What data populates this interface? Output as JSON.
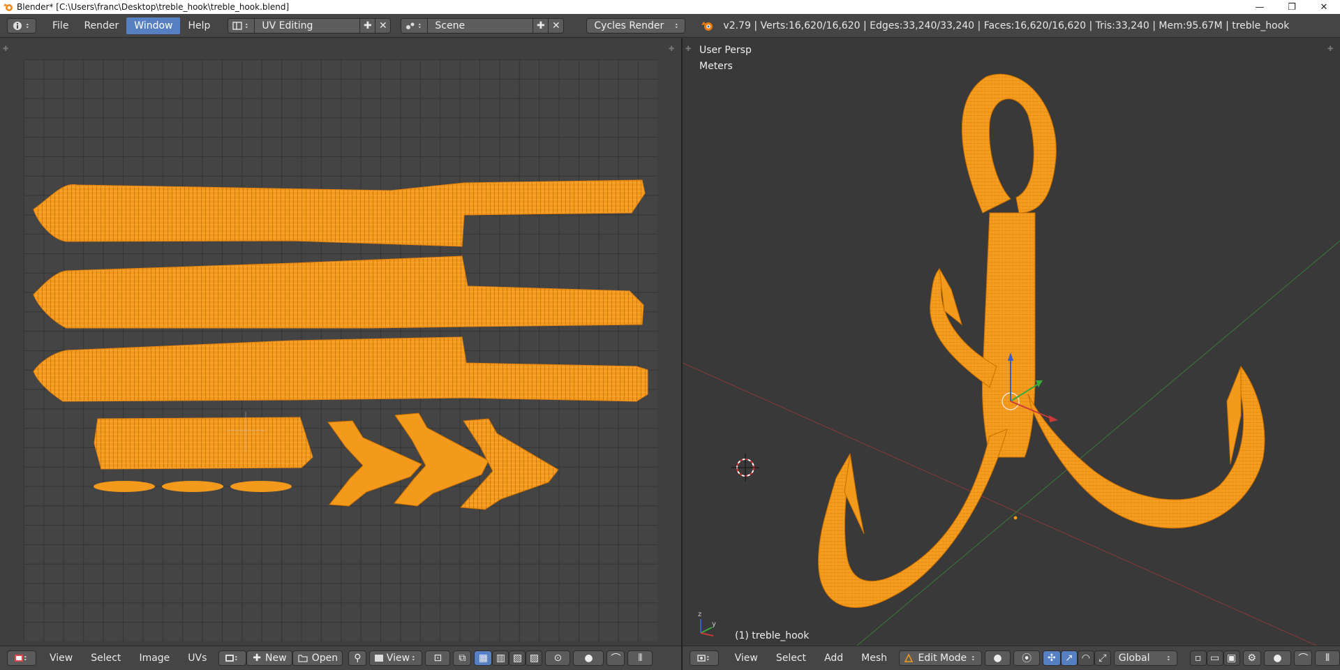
{
  "window": {
    "title": "Blender* [C:\\Users\\franc\\Desktop\\treble_hook\\treble_hook.blend]",
    "controls": {
      "minimize": "—",
      "restore": "❐",
      "close": "✕"
    }
  },
  "info_header": {
    "menus": [
      "File",
      "Render",
      "Window",
      "Help"
    ],
    "active_menu": "Window",
    "screen_layout": "UV Editing",
    "scene": "Scene",
    "render_engine": "Cycles Render",
    "stats": "v2.79 | Verts:16,620/16,620 | Edges:33,240/33,240 | Faces:16,620/16,620 | Tris:33,240 | Mem:95.67M | treble_hook"
  },
  "view3d": {
    "view_name": "User Persp",
    "units": "Meters",
    "object_label": "(1) treble_hook",
    "colors": {
      "mesh": "#f39a1c",
      "wire": "#c96f00",
      "x_axis": "#c04040",
      "y_axis": "#3a9a3a"
    }
  },
  "uv_footer": {
    "menus": [
      "View",
      "Select",
      "Image",
      "UVs"
    ],
    "new_label": "New",
    "open_label": "Open",
    "view_label": "View"
  },
  "view3d_footer": {
    "menus": [
      "View",
      "Select",
      "Add",
      "Mesh"
    ],
    "mode": "Edit Mode",
    "orientation": "Global"
  }
}
